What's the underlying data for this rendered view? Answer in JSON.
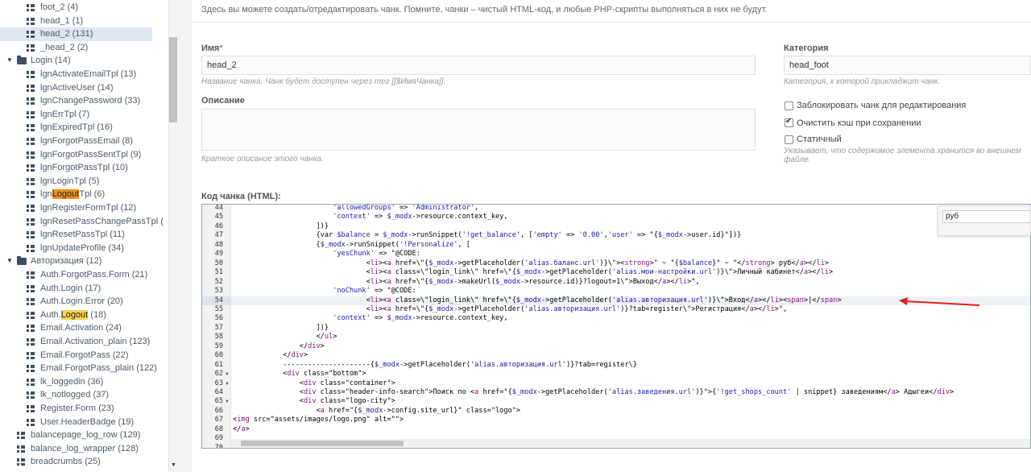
{
  "tree": {
    "rows": [
      {
        "label": "foot_2 (4)",
        "kind": "chunk",
        "indent": 2
      },
      {
        "label": "head_1 (1)",
        "kind": "chunk",
        "indent": 2
      },
      {
        "label": "head_2 (131)",
        "kind": "chunk",
        "indent": 2,
        "selected": true
      },
      {
        "label": "_head_2 (2)",
        "kind": "chunk",
        "indent": 2
      },
      {
        "label": "Login (14)",
        "kind": "folder",
        "indent": 1
      },
      {
        "label": "lgnActivateEmailTpl (13)",
        "kind": "chunk",
        "indent": 2
      },
      {
        "label": "lgnActiveUser (14)",
        "kind": "chunk",
        "indent": 2
      },
      {
        "label": "lgnChangePassword (33)",
        "kind": "chunk",
        "indent": 2
      },
      {
        "label": "lgnErrTpl (7)",
        "kind": "chunk",
        "indent": 2
      },
      {
        "label": "lgnExpiredTpl (16)",
        "kind": "chunk",
        "indent": 2
      },
      {
        "label": "lgnForgotPassEmail (8)",
        "kind": "chunk",
        "indent": 2
      },
      {
        "label": "lgnForgotPassSentTpl (9)",
        "kind": "chunk",
        "indent": 2
      },
      {
        "label": "lgnForgotPassTpl (10)",
        "kind": "chunk",
        "indent": 2
      },
      {
        "label": "lgnLoginTpl (5)",
        "kind": "chunk",
        "indent": 2
      },
      {
        "label_parts": [
          "lgn",
          "Logout",
          "Tpl (6)"
        ],
        "highlight": "orange",
        "kind": "chunk",
        "indent": 2
      },
      {
        "label": "lgnRegisterFormTpl (12)",
        "kind": "chunk",
        "indent": 2
      },
      {
        "label": "lgnResetPassChangePassTpl (",
        "kind": "chunk",
        "indent": 2
      },
      {
        "label": "lgnResetPassTpl (11)",
        "kind": "chunk",
        "indent": 2
      },
      {
        "label": "lgnUpdateProfile (34)",
        "kind": "chunk",
        "indent": 2
      },
      {
        "label": "Авторизация (12)",
        "kind": "folder",
        "indent": 1
      },
      {
        "label": "Auth.ForgotPass.Form (21)",
        "kind": "chunk",
        "indent": 2
      },
      {
        "label": "Auth.Login (17)",
        "kind": "chunk",
        "indent": 2
      },
      {
        "label": "Auth.Login.Error (20)",
        "kind": "chunk",
        "indent": 2
      },
      {
        "label_parts": [
          "Auth.",
          "Logout",
          " (18)"
        ],
        "highlight": "yellow",
        "kind": "chunk",
        "indent": 2
      },
      {
        "label": "Email.Activation (24)",
        "kind": "chunk",
        "indent": 2
      },
      {
        "label": "Email.Activation_plain (123)",
        "kind": "chunk",
        "indent": 2
      },
      {
        "label": "Email.ForgotPass (22)",
        "kind": "chunk",
        "indent": 2
      },
      {
        "label": "Email.ForgotPass_plain (122)",
        "kind": "chunk",
        "indent": 2
      },
      {
        "label": "lk_loggedin (36)",
        "kind": "chunk",
        "indent": 2
      },
      {
        "label": "lk_notlogged (37)",
        "kind": "chunk",
        "indent": 2
      },
      {
        "label": "Register.Form (23)",
        "kind": "chunk",
        "indent": 2
      },
      {
        "label": "User.HeaderBadge (19)",
        "kind": "chunk",
        "indent": 2
      },
      {
        "label": "balancepage_log_row (129)",
        "kind": "chunk",
        "indent": 1
      },
      {
        "label": "balance_log_wrapper (128)",
        "kind": "chunk",
        "indent": 1
      },
      {
        "label": "breadcrumbs (25)",
        "kind": "chunk",
        "indent": 1
      }
    ]
  },
  "form": {
    "intro": "Здесь вы можете создать/отредактировать чанк. Помните, чанки – чистый HTML-код, и любые PHP-скрипты выполняться в них не будут.",
    "name_label": "Имя",
    "name_required": "*",
    "name_value": "head_2",
    "name_hint": "Название чанка. Чанк будет доступен через тег [[$ИмяЧанка]].",
    "description_label": "Описание",
    "description_value": "",
    "description_hint": "Краткое описание этого чанка.",
    "category_label": "Категория",
    "category_value": "head_foot",
    "category_hint": "Категория, к которой прикладжит чанк.",
    "lock_label": "Заблокировать чанк для редактирования",
    "lock_checked": false,
    "clear_cache_label": "Очистить кэш при сохранении",
    "clear_cache_checked": true,
    "static_label": "Статичный",
    "static_checked": false,
    "static_hint": "Указывает, что содержимое элемента хранится во внешнем файле.",
    "code_label": "Код чанка (HTML):"
  },
  "editor": {
    "search_value": "руб",
    "active_line": 54,
    "lines": [
      {
        "n": "44",
        "fold": false,
        "text": "                        'allowedGroups' => 'Administrator',"
      },
      {
        "n": "45",
        "fold": false,
        "text": "                        'context' => $_modx->resource.context_key,"
      },
      {
        "n": "46",
        "fold": false,
        "text": "                    ])}"
      },
      {
        "n": "47",
        "fold": false,
        "text": "                    {var $balance = $_modx->runSnippet('!get_balance', ['empty' => '0.00','user' => \"{$_modx->user.id}\"])}"
      },
      {
        "n": "48",
        "fold": false,
        "text": "                    {$_modx->runSnippet('!Personalize', ["
      },
      {
        "n": "49",
        "fold": false,
        "text": "                        'yesChunk' => \"@CODE:"
      },
      {
        "n": "50",
        "fold": false,
        "text": "                                <li><a href=\\\"{$_modx->getPlaceholder('alias.баланс.url')}\\\"><strong>\" ~ \"{$balance}\" ~ \"</strong> руб</a></li>"
      },
      {
        "n": "51",
        "fold": false,
        "text": "                                <li><a class=\\\"login_link\\\" href=\\\"{$_modx->getPlaceholder('alias.мои-настройки.url')}\\\">Личный кабинет</a></li>"
      },
      {
        "n": "52",
        "fold": false,
        "text": "                                <li><a href=\\\"{$_modx->makeUrl($_modx->resource.id)}?logout=1\\\">Выход</a></li>\","
      },
      {
        "n": "53",
        "fold": false,
        "text": "                        'noChunk' => \"@CODE:"
      },
      {
        "n": "54",
        "fold": false,
        "text": "                                <li><a class=\\\"login_link\\\" href=\\\"{$_modx->getPlaceholder('alias.авторизация.url')}\\\">Вход</a></li><span>|</span>"
      },
      {
        "n": "55",
        "fold": false,
        "text": "                                <li><a href=\\\"{$_modx->getPlaceholder('alias.авторизация.url')}?tab=register\\\">Регистрация</a></li>\","
      },
      {
        "n": "56",
        "fold": false,
        "text": "                        'context' => $_modx->resource.context_key,"
      },
      {
        "n": "57",
        "fold": false,
        "text": "                    ])}"
      },
      {
        "n": "58",
        "fold": false,
        "text": "                    </ul>"
      },
      {
        "n": "59",
        "fold": false,
        "text": "                </div>"
      },
      {
        "n": "60",
        "fold": false,
        "text": "            </div>"
      },
      {
        "n": "61",
        "fold": false,
        "text": "            ---------------------{$_modx->getPlaceholder('alias.авторизация.url')}?tab=register\\}"
      },
      {
        "n": "62",
        "fold": true,
        "text": "            <div class=\"bottom\">"
      },
      {
        "n": "63",
        "fold": true,
        "text": "                <div class=\"container\">"
      },
      {
        "n": "64",
        "fold": false,
        "text": "                <div class=\"header-info-search\">Поиск по <a href=\"{$_modx->getPlaceholder('alias.заведения.url')}\">{'!get_shops_count' | snippet} заведениям</a> Адыгеи</div>"
      },
      {
        "n": "65",
        "fold": true,
        "text": "                <div class=\"logo-city\">"
      },
      {
        "n": "66",
        "fold": false,
        "text": "                    <a href=\"{$_modx->config.site_url}\" class=\"logo\">"
      },
      {
        "n": "67",
        "fold": false,
        "text": "<img src=\"assets/images/logo.png\" alt=\"\">"
      },
      {
        "n": "68",
        "fold": false,
        "text": "</a>"
      },
      {
        "n": "69",
        "fold": false,
        "text": ""
      },
      {
        "n": "70",
        "fold": false,
        "text": ""
      }
    ]
  },
  "colors": {
    "accent_arrow": "#e02020",
    "tree_text": "#4c5a6a",
    "selected_row": "#dfe6ef"
  }
}
